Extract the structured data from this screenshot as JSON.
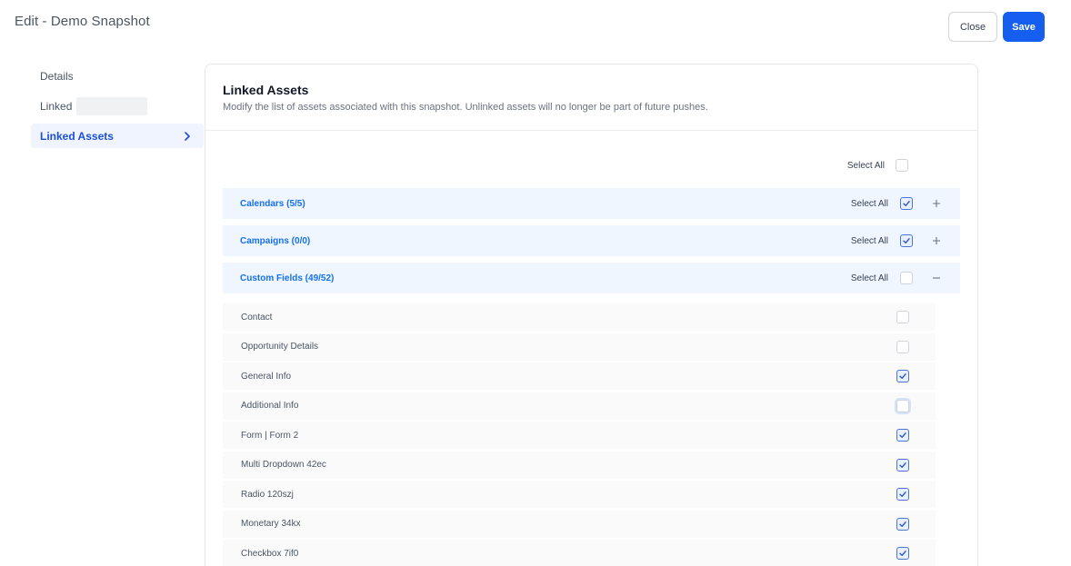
{
  "header": {
    "title": "Edit - Demo Snapshot",
    "close_label": "Close",
    "save_label": "Save"
  },
  "nav": {
    "items": [
      {
        "label": "Details"
      },
      {
        "label": "Linked"
      },
      {
        "label": "Linked Assets"
      }
    ]
  },
  "card": {
    "title": "Linked Assets",
    "description": "Modify the list of assets associated with this snapshot. Unlinked assets will no longer be part of future pushes.",
    "select_all_label": "Select All",
    "select_all_checked": false,
    "groups": [
      {
        "title": "Calendars (5/5)",
        "select_all_label": "Select All",
        "checked": true,
        "expanded": false
      },
      {
        "title": "Campaigns (0/0)",
        "select_all_label": "Select All",
        "checked": true,
        "expanded": false
      },
      {
        "title": "Custom Fields (49/52)",
        "select_all_label": "Select All",
        "checked": false,
        "expanded": true
      }
    ],
    "items": [
      {
        "label": "Contact",
        "checked": false
      },
      {
        "label": "Opportunity Details",
        "checked": false
      },
      {
        "label": "General Info",
        "checked": true
      },
      {
        "label": "Additional Info",
        "checked": false
      },
      {
        "label": "Form | Form 2",
        "checked": true
      },
      {
        "label": "Multi Dropdown 42ec",
        "checked": true
      },
      {
        "label": "Radio 120szj",
        "checked": true
      },
      {
        "label": "Monetary 34kx",
        "checked": true
      },
      {
        "label": "Checkbox 7if0",
        "checked": true
      }
    ]
  },
  "colors": {
    "accent": "#155eef",
    "group_bg": "#eff6ff",
    "group_title": "#1570ef",
    "active_nav_bg": "#eff4ff"
  }
}
